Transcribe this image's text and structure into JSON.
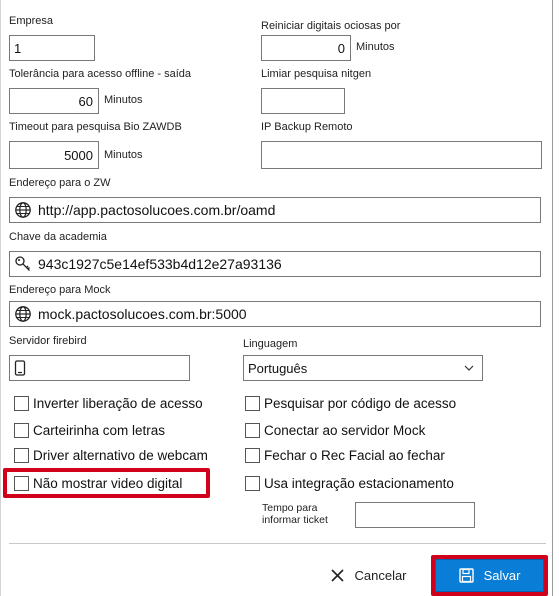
{
  "fields": {
    "empresa": {
      "label": "Empresa",
      "value": "1"
    },
    "reiniciar": {
      "label": "Reiniciar digitais ociosas por",
      "value": "0",
      "unit": "Minutos"
    },
    "tolerancia": {
      "label": "Tolerância para acesso offline - saída",
      "value": "60",
      "unit": "Minutos"
    },
    "limiar": {
      "label": "Limiar pesquisa nitgen",
      "value": ""
    },
    "timeout": {
      "label": "Timeout para pesquisa Bio ZAWDB",
      "value": "5000",
      "unit": "Minutos"
    },
    "ip_backup": {
      "label": "IP Backup Remoto",
      "value": ""
    },
    "endereco_zw": {
      "label": "Endereço para o ZW",
      "value": "http://app.pactosolucoes.com.br/oamd",
      "icon": "globe-icon"
    },
    "chave": {
      "label": "Chave da academia",
      "value": "943c1927c5e14ef533b4d12e27a93136",
      "icon": "key-icon"
    },
    "endereco_mock": {
      "label": "Endereço para Mock",
      "value": "mock.pactosolucoes.com.br:5000",
      "icon": "globe-icon"
    },
    "servidor": {
      "label": "Servidor firebird",
      "value": "",
      "icon": "phone-icon"
    },
    "linguagem": {
      "label": "Linguagem",
      "value": "Português"
    },
    "tempo": {
      "label_line1": "Tempo para",
      "label_line2": "informar ticket",
      "value": ""
    }
  },
  "checkboxes_left": [
    {
      "label": "Inverter liberação de acesso",
      "checked": false
    },
    {
      "label": "Carteirinha com letras",
      "checked": false
    },
    {
      "label": "Driver alternativo de webcam",
      "checked": false
    },
    {
      "label": "Não mostrar video digital",
      "checked": false,
      "highlighted": true
    }
  ],
  "checkboxes_right": [
    {
      "label": "Pesquisar por código de acesso",
      "checked": false
    },
    {
      "label": "Conectar ao servidor Mock",
      "checked": false
    },
    {
      "label": "Fechar o Rec Facial ao fechar",
      "checked": false
    },
    {
      "label": "Usa integração estacionamento",
      "checked": false
    }
  ],
  "buttons": {
    "cancel": {
      "label": "Cancelar",
      "icon": "close-icon"
    },
    "save": {
      "label": "Salvar",
      "icon": "floppy-disk-icon"
    }
  },
  "colors": {
    "highlight": "#d0021b",
    "save_bg": "#0a7ed6",
    "save_border": "#0062b0"
  }
}
